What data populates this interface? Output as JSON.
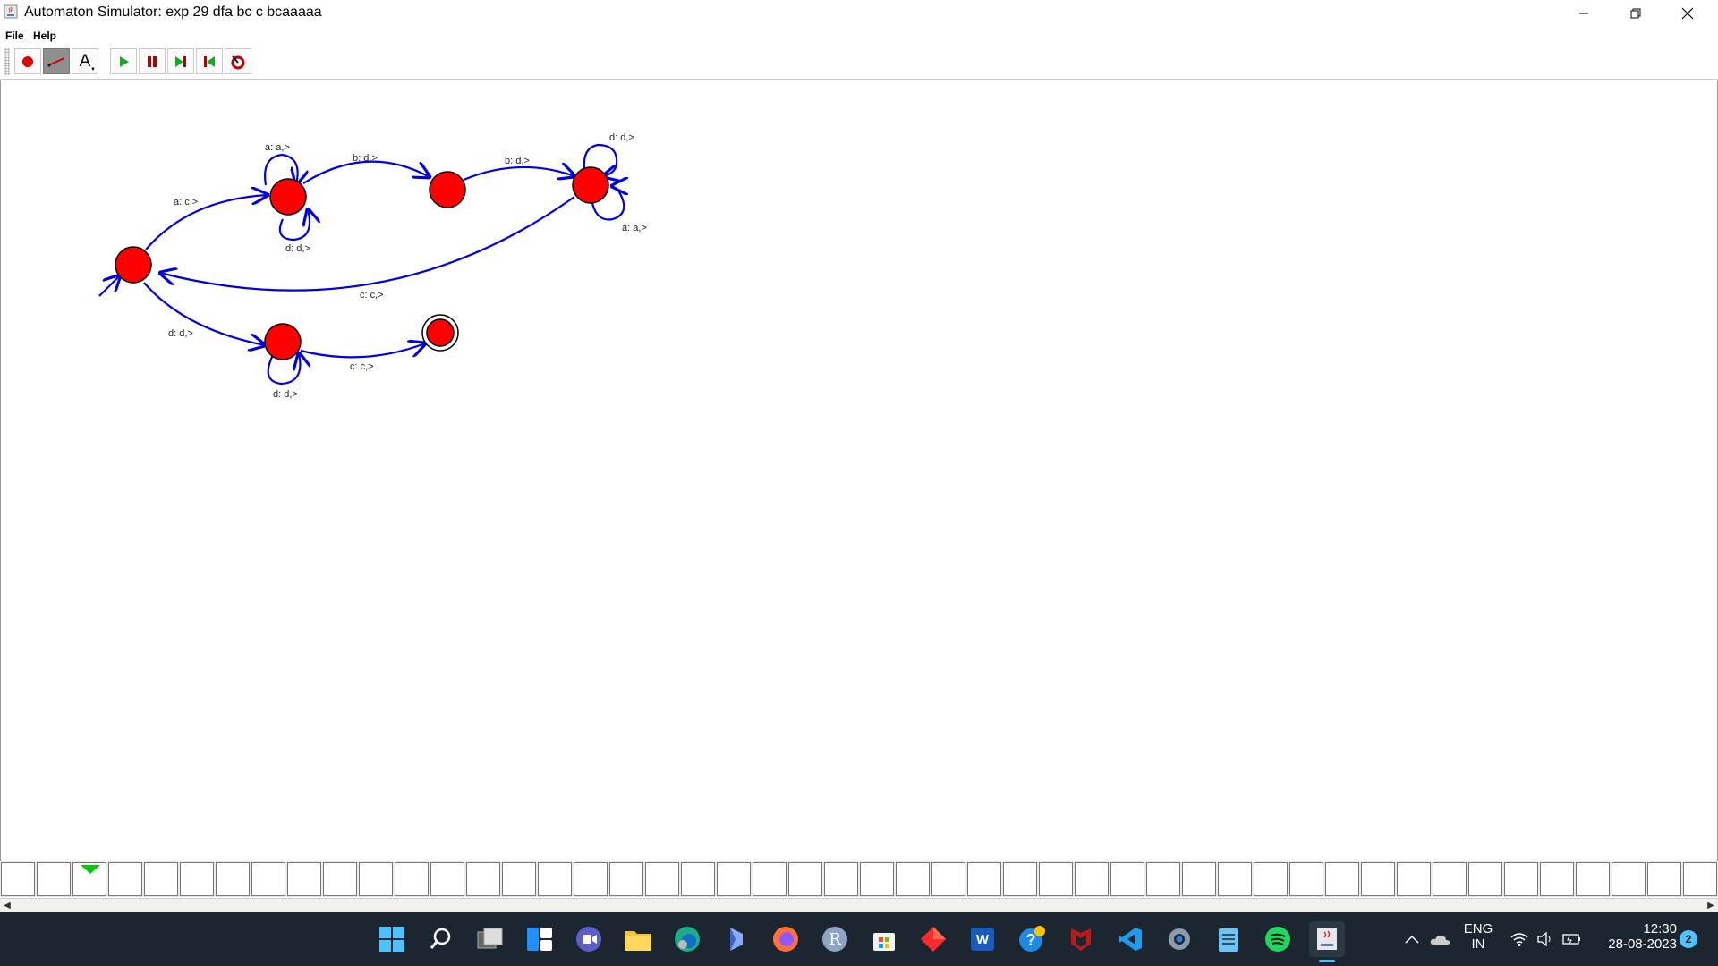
{
  "window": {
    "title": "Automaton Simulator: exp 29 dfa bc c bcaaaaa"
  },
  "menubar": {
    "items": [
      {
        "label": "File"
      },
      {
        "label": "Help"
      }
    ]
  },
  "toolbar": {
    "tools": [
      {
        "name": "add-state-tool",
        "icon": "red-dot-icon"
      },
      {
        "name": "add-transition-tool",
        "icon": "arrow-line-icon",
        "selected": true
      },
      {
        "name": "add-text-tool",
        "icon": "text-a-icon",
        "glyph": "A"
      },
      {
        "name": "run-button",
        "icon": "play-icon"
      },
      {
        "name": "pause-button",
        "icon": "pause-icon"
      },
      {
        "name": "step-button",
        "icon": "step-forward-icon"
      },
      {
        "name": "rewind-button",
        "icon": "rewind-icon"
      },
      {
        "name": "reset-button",
        "icon": "reset-icon"
      }
    ]
  },
  "diagram": {
    "state_color": "#ff0000",
    "edge_color": "#0000e6",
    "states": [
      {
        "id": "q0",
        "initial": true,
        "final": false
      },
      {
        "id": "q1",
        "initial": false,
        "final": false
      },
      {
        "id": "q2",
        "initial": false,
        "final": false
      },
      {
        "id": "q3",
        "initial": false,
        "final": false
      },
      {
        "id": "q4",
        "initial": false,
        "final": false
      },
      {
        "id": "q5",
        "initial": false,
        "final": true
      }
    ],
    "transitions": [
      {
        "from": "q0",
        "to": "q1",
        "label": "a: c,>"
      },
      {
        "from": "q1",
        "to": "q1",
        "label": "a: a,>"
      },
      {
        "from": "q1",
        "to": "q1",
        "label": "d: d,>"
      },
      {
        "from": "q1",
        "to": "q2",
        "label": "b: d,>"
      },
      {
        "from": "q2",
        "to": "q3",
        "label": "b: d,>"
      },
      {
        "from": "q3",
        "to": "q3",
        "label": "d: d,>"
      },
      {
        "from": "q3",
        "to": "q3",
        "label": "a: a,>"
      },
      {
        "from": "q3",
        "to": "q0",
        "label": "c: c,>"
      },
      {
        "from": "q0",
        "to": "q4",
        "label": "d: d,>"
      },
      {
        "from": "q4",
        "to": "q4",
        "label": "d: d,>"
      },
      {
        "from": "q4",
        "to": "q5",
        "label": "c: c,>"
      }
    ]
  },
  "tape": {
    "head_index": 2,
    "head_color": "#00cc00"
  },
  "taskbar": {
    "apps": [
      {
        "name": "start-icon"
      },
      {
        "name": "search-icon"
      },
      {
        "name": "task-view-icon"
      },
      {
        "name": "widgets-icon"
      },
      {
        "name": "teams-chat-icon"
      },
      {
        "name": "file-explorer-icon"
      },
      {
        "name": "edge-icon"
      },
      {
        "name": "bing-icon"
      },
      {
        "name": "firefox-icon"
      },
      {
        "name": "r-icon",
        "glyph": "R"
      },
      {
        "name": "store-icon"
      },
      {
        "name": "app-red-diamond-icon"
      },
      {
        "name": "word-icon",
        "glyph": "W"
      },
      {
        "name": "help-icon",
        "glyph": "?"
      },
      {
        "name": "mcafee-icon"
      },
      {
        "name": "vscode-icon"
      },
      {
        "name": "settings-icon"
      },
      {
        "name": "notepad-icon"
      },
      {
        "name": "spotify-icon"
      },
      {
        "name": "java-icon"
      }
    ],
    "tray": {
      "language_line1": "ENG",
      "language_line2": "IN",
      "time": "12:30",
      "date": "28-08-2023",
      "notification_count": "2"
    }
  }
}
